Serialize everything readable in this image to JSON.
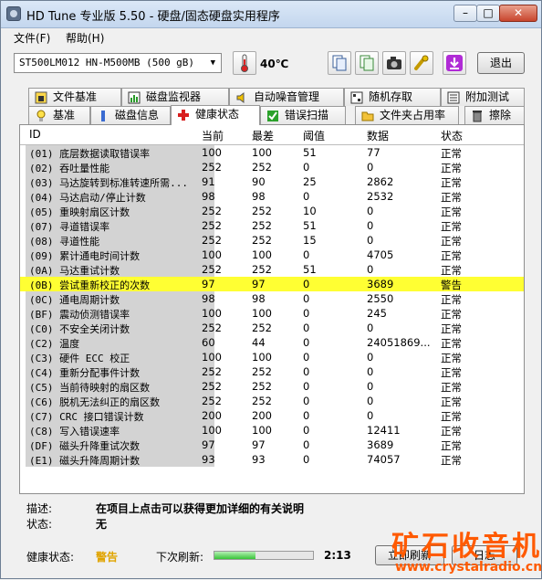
{
  "window": {
    "title": "HD Tune 专业版 5.50 - 硬盘/固态硬盘实用程序",
    "min": "–",
    "max": "□",
    "close": "✕"
  },
  "menu": {
    "file": "文件(F)",
    "help": "帮助(H)"
  },
  "toolbar": {
    "drive": "ST500LM012 HN-M500MB (500 gB)",
    "temperature": "40℃",
    "exit": "退出"
  },
  "tabs_top": [
    {
      "label": "文件基准",
      "icon": "file-benchmark-icon"
    },
    {
      "label": "磁盘监视器",
      "icon": "disk-monitor-icon"
    },
    {
      "label": "自动噪音管理",
      "icon": "speaker-icon"
    },
    {
      "label": "随机存取",
      "icon": "random-access-icon"
    },
    {
      "label": "附加测试",
      "icon": "extra-tests-icon"
    }
  ],
  "tabs_bottom": [
    {
      "label": "基准",
      "icon": "benchmark-icon"
    },
    {
      "label": "磁盘信息",
      "icon": "disk-info-icon"
    },
    {
      "label": "健康状态",
      "icon": "health-icon"
    },
    {
      "label": "错误扫描",
      "icon": "error-scan-icon"
    },
    {
      "label": "文件夹占用率",
      "icon": "folder-usage-icon"
    },
    {
      "label": "擦除",
      "icon": "erase-icon"
    }
  ],
  "columns": {
    "id": "ID",
    "current": "当前",
    "worst": "最差",
    "threshold": "阈值",
    "data": "数据",
    "status": "状态"
  },
  "rows": [
    {
      "id": "(01) 底层数据读取错误率",
      "cur": "100",
      "worst": "100",
      "thr": "51",
      "data": "77",
      "status": "正常"
    },
    {
      "id": "(02) 吞吐量性能",
      "cur": "252",
      "worst": "252",
      "thr": "0",
      "data": "0",
      "status": "正常"
    },
    {
      "id": "(03) 马达旋转到标准转速所需...",
      "cur": "91",
      "worst": "90",
      "thr": "25",
      "data": "2862",
      "status": "正常"
    },
    {
      "id": "(04) 马达启动/停止计数",
      "cur": "98",
      "worst": "98",
      "thr": "0",
      "data": "2532",
      "status": "正常"
    },
    {
      "id": "(05) 重映射扇区计数",
      "cur": "252",
      "worst": "252",
      "thr": "10",
      "data": "0",
      "status": "正常"
    },
    {
      "id": "(07) 寻道错误率",
      "cur": "252",
      "worst": "252",
      "thr": "51",
      "data": "0",
      "status": "正常"
    },
    {
      "id": "(08) 寻道性能",
      "cur": "252",
      "worst": "252",
      "thr": "15",
      "data": "0",
      "status": "正常"
    },
    {
      "id": "(09) 累计通电时间计数",
      "cur": "100",
      "worst": "100",
      "thr": "0",
      "data": "4705",
      "status": "正常"
    },
    {
      "id": "(0A) 马达重试计数",
      "cur": "252",
      "worst": "252",
      "thr": "51",
      "data": "0",
      "status": "正常"
    },
    {
      "id": "(0B) 尝试重新校正的次数",
      "cur": "97",
      "worst": "97",
      "thr": "0",
      "data": "3689",
      "status": "警告",
      "warn": true
    },
    {
      "id": "(0C) 通电周期计数",
      "cur": "98",
      "worst": "98",
      "thr": "0",
      "data": "2550",
      "status": "正常"
    },
    {
      "id": "(BF) 震动侦测错误率",
      "cur": "100",
      "worst": "100",
      "thr": "0",
      "data": "245",
      "status": "正常"
    },
    {
      "id": "(C0) 不安全关闭计数",
      "cur": "252",
      "worst": "252",
      "thr": "0",
      "data": "0",
      "status": "正常"
    },
    {
      "id": "(C2) 温度",
      "cur": "60",
      "worst": "44",
      "thr": "0",
      "data": "24051869...",
      "status": "正常"
    },
    {
      "id": "(C3) 硬件 ECC 校正",
      "cur": "100",
      "worst": "100",
      "thr": "0",
      "data": "0",
      "status": "正常"
    },
    {
      "id": "(C4) 重新分配事件计数",
      "cur": "252",
      "worst": "252",
      "thr": "0",
      "data": "0",
      "status": "正常"
    },
    {
      "id": "(C5) 当前待映射的扇区数",
      "cur": "252",
      "worst": "252",
      "thr": "0",
      "data": "0",
      "status": "正常"
    },
    {
      "id": "(C6) 脱机无法纠正的扇区数",
      "cur": "252",
      "worst": "252",
      "thr": "0",
      "data": "0",
      "status": "正常"
    },
    {
      "id": "(C7) CRC 接口错误计数",
      "cur": "200",
      "worst": "200",
      "thr": "0",
      "data": "0",
      "status": "正常"
    },
    {
      "id": "(C8) 写入错误速率",
      "cur": "100",
      "worst": "100",
      "thr": "0",
      "data": "12411",
      "status": "正常"
    },
    {
      "id": "(DF) 磁头升降重试次数",
      "cur": "97",
      "worst": "97",
      "thr": "0",
      "data": "3689",
      "status": "正常"
    },
    {
      "id": "(E1) 磁头升降周期计数",
      "cur": "93",
      "worst": "93",
      "thr": "0",
      "data": "74057",
      "status": "正常"
    }
  ],
  "description": {
    "desc_label": "描述:",
    "desc_value": "在项目上点击可以获得更加详细的有关说明",
    "state_label": "状态:",
    "state_value": "无"
  },
  "status": {
    "health_label": "健康状态:",
    "health_value": "警告",
    "refresh_label": "下次刷新:",
    "refresh_time": "2:13",
    "refresh_progress": 0.42,
    "refresh_button": "立即刷新",
    "log_button": "日志"
  },
  "watermark": {
    "big": "矿石收音机",
    "small": "www.crystalradio.cn"
  },
  "colors": {
    "warning_row": "#ffff33",
    "warning_text": "#e0a400",
    "watermark": "#ff5a00"
  }
}
